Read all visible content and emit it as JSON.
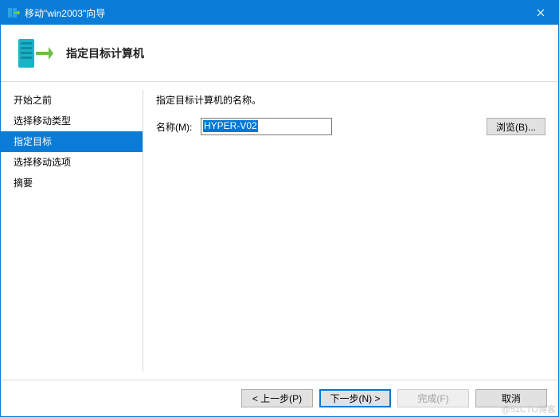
{
  "titlebar": {
    "title": "移动\"win2003\"向导"
  },
  "header": {
    "heading": "指定目标计算机"
  },
  "sidebar": {
    "items": [
      {
        "label": "开始之前",
        "active": false
      },
      {
        "label": "选择移动类型",
        "active": false
      },
      {
        "label": "指定目标",
        "active": true
      },
      {
        "label": "选择移动选项",
        "active": false
      },
      {
        "label": "摘要",
        "active": false
      }
    ]
  },
  "content": {
    "instruction": "指定目标计算机的名称。",
    "name_label": "名称(M):",
    "name_value": "HYPER-V02",
    "browse_label": "浏览(B)..."
  },
  "footer": {
    "prev": "< 上一步(P)",
    "next": "下一步(N) >",
    "finish": "完成(F)",
    "cancel": "取消"
  },
  "watermark": "@51CTO博客"
}
